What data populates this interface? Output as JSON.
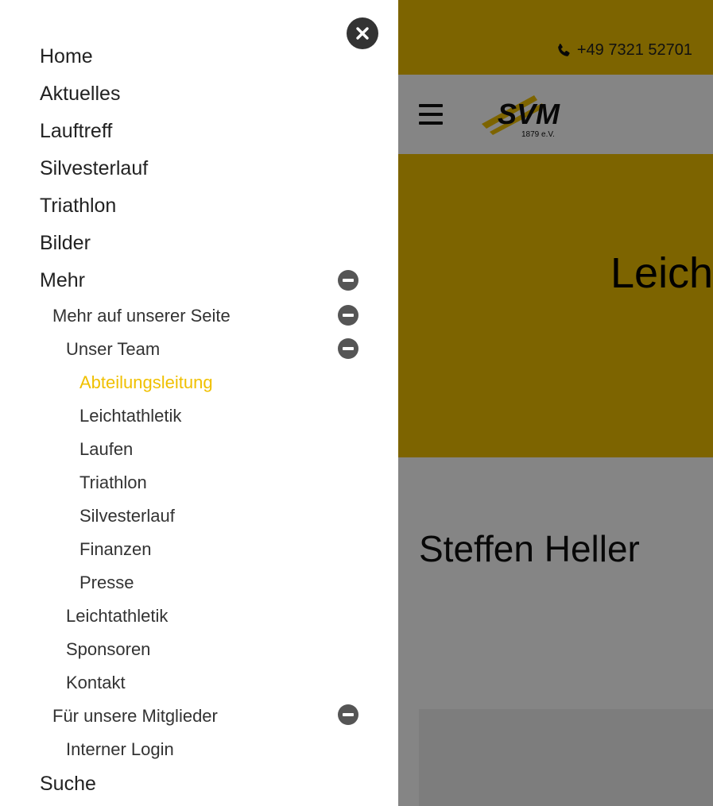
{
  "header": {
    "phone": "+49 7321 52701",
    "phone_icon": "phone-icon",
    "menu_icon": "hamburger-icon",
    "logo": {
      "text": "SVM",
      "subtext": "1879 e.V."
    }
  },
  "hero": {
    "title": "Leich"
  },
  "content": {
    "person_name": "Steffen Heller"
  },
  "menu": {
    "close_icon": "close-icon",
    "items": [
      {
        "label": "Home"
      },
      {
        "label": "Aktuelles"
      },
      {
        "label": "Lauftreff"
      },
      {
        "label": "Silvesterlauf"
      },
      {
        "label": "Triathlon"
      },
      {
        "label": "Bilder"
      },
      {
        "label": "Mehr",
        "expanded": true
      },
      {
        "label": "Mehr auf unserer Seite",
        "expanded": true
      },
      {
        "label": "Unser Team",
        "expanded": true
      },
      {
        "label": "Abteilungsleitung",
        "active": true
      },
      {
        "label": "Leichtathletik"
      },
      {
        "label": "Laufen"
      },
      {
        "label": "Triathlon"
      },
      {
        "label": "Silvesterlauf"
      },
      {
        "label": "Finanzen"
      },
      {
        "label": "Presse"
      },
      {
        "label": "Leichtathletik"
      },
      {
        "label": "Sponsoren"
      },
      {
        "label": "Kontakt"
      },
      {
        "label": "Für unsere Mitglieder",
        "expanded": true
      },
      {
        "label": "Interner Login"
      },
      {
        "label": "Suche"
      }
    ]
  },
  "colors": {
    "accent": "#f0c000",
    "overlay": "rgba(0,0,0,0.48)",
    "close_button": "#333333",
    "collapse_icon": "#555555"
  }
}
